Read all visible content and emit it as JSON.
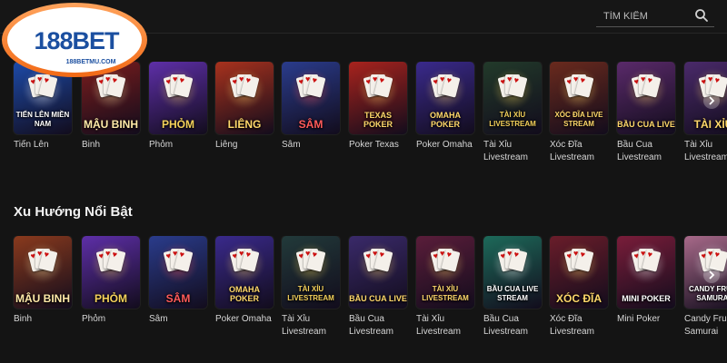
{
  "brand": {
    "logo_text": "188BET",
    "logo_url": "188BETMU.COM"
  },
  "search": {
    "placeholder": "TÌM KIẾM"
  },
  "sections": [
    {
      "title": "",
      "items": [
        {
          "art": "TIẾN LÊN MIỀN NAM",
          "label": "Tiến Lên",
          "theme": "#1d4aa8",
          "accent": "#ffffff"
        },
        {
          "art": "MẬU BINH",
          "label": "Binh",
          "theme": "#7a1d1d",
          "accent": "#ffe9a8"
        },
        {
          "art": "PHỎM",
          "label": "Phỏm",
          "theme": "#5e2fa8",
          "accent": "#f4d15b"
        },
        {
          "art": "LIÊNG",
          "label": "Liêng",
          "theme": "#a8321d",
          "accent": "#ffd86b"
        },
        {
          "art": "SÂM",
          "label": "Sâm",
          "theme": "#2a3c8c",
          "accent": "#ff5a5a"
        },
        {
          "art": "TEXAS POKER",
          "label": "Poker Texas",
          "theme": "#a8231d",
          "accent": "#ffd86b"
        },
        {
          "art": "OMAHA POKER",
          "label": "Poker Omaha",
          "theme": "#3a2a8c",
          "accent": "#ffd86b"
        },
        {
          "art": "TÀI XỈU LIVESTREAM",
          "label": "Tài Xỉu Livestream",
          "theme": "#223a2a",
          "accent": "#f4d15b"
        },
        {
          "art": "XÓC ĐĨA LIVE STREAM",
          "label": "Xóc Đĩa Livestream",
          "theme": "#6a2a1d",
          "accent": "#ffd86b"
        },
        {
          "art": "BẦU CUA LIVE",
          "label": "Bầu Cua Livestream",
          "theme": "#5a2a6a",
          "accent": "#ffd86b"
        },
        {
          "art": "TÀI XỈU",
          "label": "Tài Xỉu Livestream",
          "theme": "#4a2a6a",
          "accent": "#ffd86b"
        }
      ]
    },
    {
      "title": "Xu Hướng Nổi Bật",
      "items": [
        {
          "art": "MẬU BINH",
          "label": "Binh",
          "theme": "#8a3a1d",
          "accent": "#ffe9a8"
        },
        {
          "art": "PHỎM",
          "label": "Phỏm",
          "theme": "#5e2fa8",
          "accent": "#f4d15b"
        },
        {
          "art": "SÂM",
          "label": "Sâm",
          "theme": "#2a3c8c",
          "accent": "#ff5a5a"
        },
        {
          "art": "OMAHA POKER",
          "label": "Poker Omaha",
          "theme": "#3a2a8c",
          "accent": "#ffd86b"
        },
        {
          "art": "TÀI XỈU LIVESTREAM",
          "label": "Tài Xỉu Livestream",
          "theme": "#223a3a",
          "accent": "#f4d15b"
        },
        {
          "art": "BẦU CUA LIVE",
          "label": "Bầu Cua Livestream",
          "theme": "#3a2a6a",
          "accent": "#ffd86b"
        },
        {
          "art": "TÀI XỈU LIVESTREAM",
          "label": "Tài Xỉu Livestream",
          "theme": "#5a1d3a",
          "accent": "#ffd86b"
        },
        {
          "art": "BẦU CUA LIVE STREAM",
          "label": "Bầu Cua Livestream",
          "theme": "#1d6a5a",
          "accent": "#ffffff"
        },
        {
          "art": "XÓC ĐĨA",
          "label": "Xóc Đĩa Livestream",
          "theme": "#6a1d2a",
          "accent": "#ffd86b"
        },
        {
          "art": "MINI POKER",
          "label": "Mini Poker",
          "theme": "#7a1d3a",
          "accent": "#ffffff"
        },
        {
          "art": "CANDY FRUIT SAMURAI",
          "label": "Candy Fruit Samurai",
          "theme": "#a86a8a",
          "accent": "#ffffff"
        }
      ]
    }
  ],
  "colors": {
    "background": "#141414",
    "logo_orange": "#f47a20",
    "logo_blue": "#1b4fa0"
  },
  "icons": {
    "search": "search-icon",
    "next": "chevron-right-icon"
  }
}
